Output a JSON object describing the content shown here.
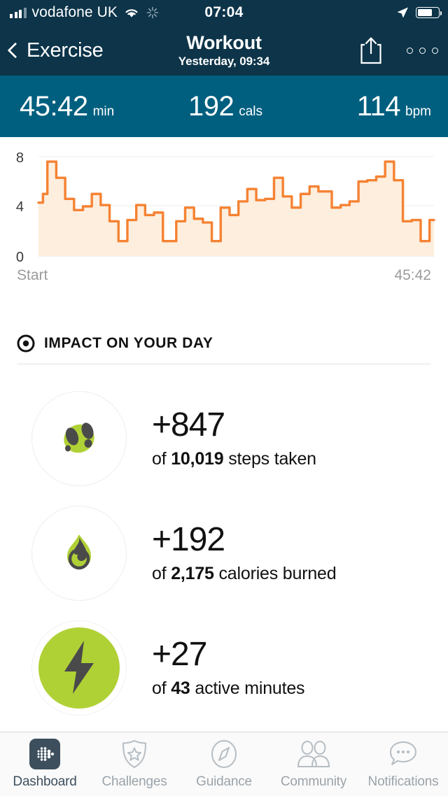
{
  "status_bar": {
    "carrier": "vodafone UK",
    "time": "07:04",
    "wifi_icon": "wifi-icon",
    "sync_icon": "sync-spinner-icon",
    "location_icon": "location-arrow-icon",
    "battery_icon": "battery-icon"
  },
  "navbar": {
    "back_label": "Exercise",
    "back_icon": "chevron-left-icon",
    "title": "Workout",
    "subtitle": "Yesterday, 09:34",
    "share_icon": "share-icon",
    "overflow_icon": "more-options-icon"
  },
  "stats": [
    {
      "value": "45:42",
      "unit": "min"
    },
    {
      "value": "192",
      "unit": "cals"
    },
    {
      "value": "114",
      "unit": "bpm"
    }
  ],
  "chart_axis": {
    "y_ticks": [
      "8",
      "4",
      "0"
    ],
    "x_start_label": "Start",
    "x_end_label": "45:42"
  },
  "chart_data": {
    "type": "area",
    "title": "",
    "xlabel": "",
    "ylabel": "",
    "ylim": [
      0,
      8
    ],
    "xlim": [
      0,
      60
    ],
    "yticks": [
      0,
      4,
      8
    ],
    "grid": true,
    "legend": "none",
    "line_color": "#f58233",
    "fill_color": "#fdeedd",
    "x_tick_labels": [
      "Start",
      "45:42"
    ],
    "step_style": "step-post",
    "x": [
      0,
      1,
      2,
      3,
      4,
      5,
      6,
      7,
      8,
      9,
      10,
      11,
      12,
      13,
      14,
      15,
      16,
      17,
      18,
      19,
      20,
      21,
      22,
      23,
      24,
      25,
      26,
      27,
      28,
      29,
      30,
      31,
      32,
      33,
      34,
      35,
      36,
      37,
      38,
      39,
      40,
      41,
      42,
      43,
      44,
      45,
      46,
      47,
      48,
      49,
      50,
      51,
      52,
      53,
      54,
      55,
      56,
      57,
      58,
      59
    ],
    "values": [
      4.3,
      5.0,
      7.6,
      7.6,
      6.3,
      6.3,
      4.6,
      4.6,
      3.7,
      3.7,
      4.0,
      4.0,
      5.0,
      5.0,
      4.1,
      4.1,
      2.8,
      2.8,
      1.2,
      1.2,
      2.9,
      2.9,
      4.1,
      4.1,
      3.3,
      3.3,
      3.5,
      3.5,
      1.2,
      1.2,
      1.2,
      2.8,
      2.8,
      3.9,
      3.9,
      3.0,
      3.0,
      2.7,
      2.7,
      1.2,
      1.2,
      3.9,
      3.9,
      3.3,
      3.3,
      4.4,
      4.4,
      5.4,
      5.4,
      4.5,
      4.5,
      4.6,
      4.6,
      6.3,
      6.3,
      4.8,
      4.8,
      3.9,
      3.9,
      5.0
    ]
  },
  "chart_data_tail": {
    "values": [
      5.0,
      5.6,
      5.6,
      5.2,
      5.2,
      5.2,
      3.9,
      3.9,
      4.1,
      4.1,
      4.4,
      4.4,
      6.0,
      6.0,
      6.1,
      6.1,
      6.4,
      6.4,
      7.6,
      7.6,
      6.1,
      6.1,
      2.8,
      2.8,
      2.9,
      2.9,
      1.2,
      1.2,
      2.9
    ]
  },
  "impact": {
    "section_title": "IMPACT ON YOUR DAY",
    "section_icon": "target-icon",
    "rows": [
      {
        "icon": "footsteps-icon",
        "delta": "+847",
        "prefix": "of ",
        "total": "10,019",
        "suffix": " steps taken"
      },
      {
        "icon": "flame-icon",
        "delta": "+192",
        "prefix": "of ",
        "total": "2,175",
        "suffix": " calories burned"
      },
      {
        "icon": "lightning-bolt-icon",
        "delta": "+27",
        "prefix": "of ",
        "total": "43",
        "suffix": " active minutes"
      }
    ]
  },
  "tabbar": {
    "tabs": [
      {
        "label": "Dashboard",
        "icon": "fitbit-logo-icon",
        "active": true
      },
      {
        "label": "Challenges",
        "icon": "shield-star-icon",
        "active": false
      },
      {
        "label": "Guidance",
        "icon": "compass-icon",
        "active": false
      },
      {
        "label": "Community",
        "icon": "people-icon",
        "active": false
      },
      {
        "label": "Notifications",
        "icon": "chat-bubble-icon",
        "active": false
      }
    ]
  },
  "colors": {
    "navbar_bg": "#0d3449",
    "stats_bg": "#005f7f",
    "chart_line": "#f58233",
    "chart_fill": "#fdeedd",
    "accent_green": "#b0d136",
    "icon_dark": "#4a4a4a",
    "tab_active": "#3d4f5d",
    "tab_inactive": "#9aa3aa"
  }
}
